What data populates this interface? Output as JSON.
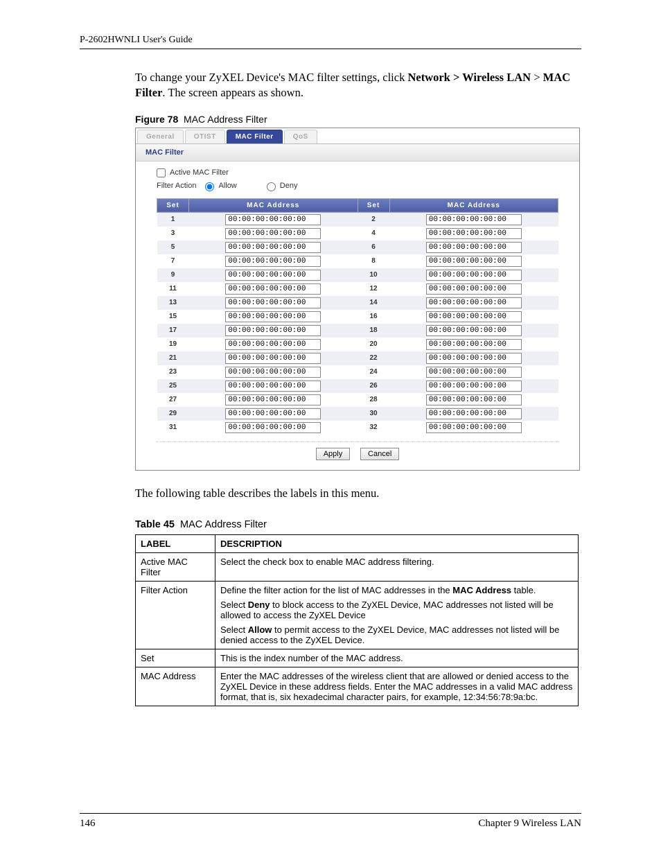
{
  "header": {
    "guide_title": "P-2602HWNLI User's Guide"
  },
  "intro": {
    "prefix": "To change your ZyXEL Device's MAC filter settings, click ",
    "path1": "Network > Wireless LAN",
    "mid": " > ",
    "path2": "MAC Filter",
    "suffix": ". The screen appears as shown."
  },
  "figure": {
    "num": "Figure 78",
    "title": "MAC Address Filter"
  },
  "ui": {
    "tabs": [
      "General",
      "OTIST",
      "MAC Filter",
      "QoS"
    ],
    "active_tab_index": 2,
    "panel_title": "MAC Filter",
    "active_mac_filter_label": "Active MAC Filter",
    "active_mac_filter_checked": false,
    "filter_action_label": "Filter Action",
    "allow_label": "Allow",
    "deny_label": "Deny",
    "filter_action_value": "allow",
    "col_set": "Set",
    "col_mac": "MAC Address",
    "rows": [
      {
        "a": 1,
        "b": 2
      },
      {
        "a": 3,
        "b": 4
      },
      {
        "a": 5,
        "b": 6
      },
      {
        "a": 7,
        "b": 8
      },
      {
        "a": 9,
        "b": 10
      },
      {
        "a": 11,
        "b": 12
      },
      {
        "a": 13,
        "b": 14
      },
      {
        "a": 15,
        "b": 16
      },
      {
        "a": 17,
        "b": 18
      },
      {
        "a": 19,
        "b": 20
      },
      {
        "a": 21,
        "b": 22
      },
      {
        "a": 23,
        "b": 24
      },
      {
        "a": 25,
        "b": 26
      },
      {
        "a": 27,
        "b": 28
      },
      {
        "a": 29,
        "b": 30
      },
      {
        "a": 31,
        "b": 32
      }
    ],
    "mac_default": "00:00:00:00:00:00",
    "apply": "Apply",
    "cancel": "Cancel"
  },
  "after_fig": "The following table describes the labels in this menu.",
  "table": {
    "num": "Table 45",
    "title": "MAC Address Filter",
    "head_label": "LABEL",
    "head_desc": "DESCRIPTION",
    "rows": [
      {
        "label": "Active MAC Filter",
        "desc": [
          {
            "segments": [
              {
                "t": "Select the check box to enable MAC address filtering."
              }
            ]
          }
        ]
      },
      {
        "label": "Filter Action",
        "desc": [
          {
            "segments": [
              {
                "t": "Define the filter action for the list of MAC addresses in the "
              },
              {
                "t": "MAC Address",
                "b": true
              },
              {
                "t": " table."
              }
            ]
          },
          {
            "segments": [
              {
                "t": "Select "
              },
              {
                "t": "Deny",
                "b": true
              },
              {
                "t": " to block access to the ZyXEL Device, MAC addresses not listed will be allowed to access the ZyXEL Device"
              }
            ]
          },
          {
            "segments": [
              {
                "t": "Select "
              },
              {
                "t": "Allow",
                "b": true
              },
              {
                "t": " to permit access to the ZyXEL Device, MAC addresses not listed will be denied access to the ZyXEL Device."
              }
            ]
          }
        ]
      },
      {
        "label": "Set",
        "desc": [
          {
            "segments": [
              {
                "t": "This is the index number of the MAC address."
              }
            ]
          }
        ]
      },
      {
        "label": "MAC Address",
        "desc": [
          {
            "segments": [
              {
                "t": "Enter the MAC addresses of the wireless client that are allowed or denied access to the ZyXEL Device in these address fields. Enter the MAC addresses in a valid MAC address format, that is, six hexadecimal character pairs, for example, 12:34:56:78:9a:bc."
              }
            ]
          }
        ]
      }
    ]
  },
  "footer": {
    "page": "146",
    "chapter": "Chapter 9 Wireless LAN"
  }
}
